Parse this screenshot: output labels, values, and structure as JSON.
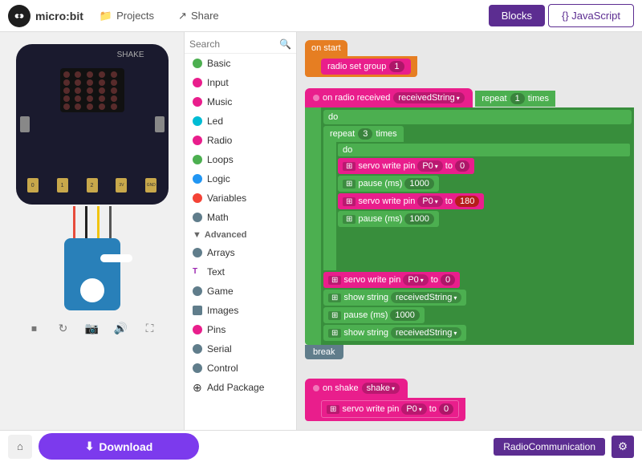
{
  "header": {
    "logo_text": "micro:bit",
    "projects_label": "Projects",
    "share_label": "Share",
    "blocks_label": "Blocks",
    "javascript_label": "{} JavaScript"
  },
  "toolbox": {
    "search_placeholder": "Search",
    "items": [
      {
        "label": "Basic",
        "color": "#4CAF50",
        "icon": "grid"
      },
      {
        "label": "Input",
        "color": "#e91e8c",
        "icon": "circle"
      },
      {
        "label": "Music",
        "color": "#e91e8c",
        "icon": "music"
      },
      {
        "label": "Led",
        "color": "#00bcd4",
        "icon": "toggle"
      },
      {
        "label": "Radio",
        "color": "#e91e8c",
        "icon": "radio"
      },
      {
        "label": "Loops",
        "color": "#4CAF50",
        "icon": "loop"
      },
      {
        "label": "Logic",
        "color": "#2196f3",
        "icon": "logic"
      },
      {
        "label": "Variables",
        "color": "#f44336",
        "icon": "list"
      },
      {
        "label": "Math",
        "color": "#607d8b",
        "icon": "math"
      },
      {
        "label": "Advanced",
        "color": "#333",
        "icon": "chevron"
      },
      {
        "label": "Arrays",
        "color": "#607d8b",
        "icon": "arrays"
      },
      {
        "label": "Text",
        "color": "#9c27b0",
        "icon": "text"
      },
      {
        "label": "Game",
        "color": "#607d8b",
        "icon": "game"
      },
      {
        "label": "Images",
        "color": "#607d8b",
        "icon": "images"
      },
      {
        "label": "Pins",
        "color": "#e91e8c",
        "icon": "pins"
      },
      {
        "label": "Serial",
        "color": "#607d8b",
        "icon": "serial"
      },
      {
        "label": "Control",
        "color": "#607d8b",
        "icon": "control"
      },
      {
        "label": "Add Package",
        "color": "#333",
        "icon": "add"
      }
    ]
  },
  "simulator": {
    "shake_label": "SHAKE",
    "pins": [
      "0",
      "1",
      "2",
      "3V",
      "GND"
    ]
  },
  "blocks": {
    "on_start": "on start",
    "radio_set_group": "radio set group",
    "on_radio_received": "on radio received",
    "received_string": "receivedString",
    "repeat_label": "repeat",
    "times_label": "times",
    "do_label": "do",
    "servo_write_pin": "servo write pin",
    "to_label": "to",
    "pause_ms": "pause (ms)",
    "show_string": "show string",
    "break_label": "break",
    "on_shake": "on shake",
    "val_1": "1",
    "val_3": "3",
    "val_1000": "1000",
    "val_0": "0",
    "val_180": "180",
    "pin_p0": "P0",
    "group_1": "1"
  },
  "bottom": {
    "download_label": "Download",
    "project_name": "RadioCommunication"
  }
}
